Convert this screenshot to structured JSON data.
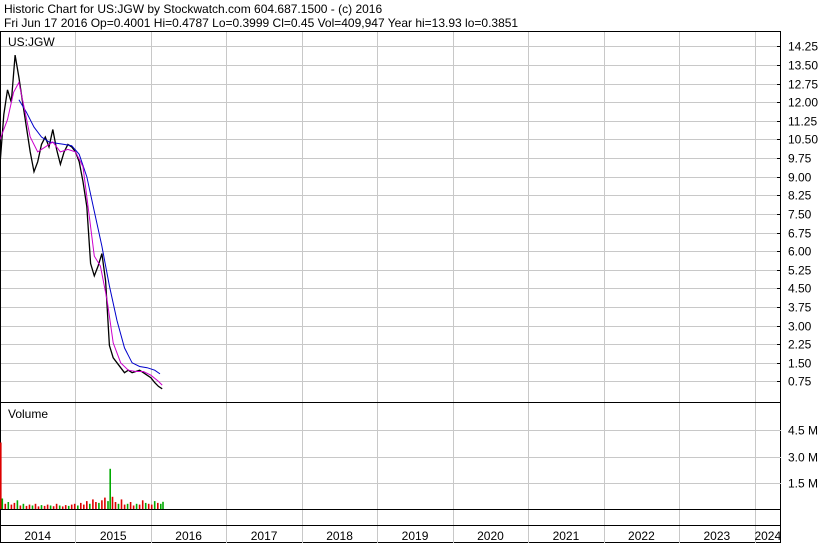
{
  "header": {
    "title": "Historic Chart for US:JGW by Stockwatch.com 604.687.1500 - (c) 2016",
    "quote": "Fri Jun 17 2016   Op=0.4001   Hi=0.4787   Lo=0.3999   Cl=0.45   Vol=409,947   Year hi=13.93   lo=0.3851"
  },
  "chart_data": {
    "type": "line",
    "symbol": "US:JGW",
    "price_ylim": [
      0,
      14.75
    ],
    "price_ticks": [
      "14.25",
      "13.50",
      "12.75",
      "12.00",
      "11.25",
      "10.50",
      "9.75",
      "9.00",
      "8.25",
      "7.50",
      "6.75",
      "6.00",
      "5.25",
      "4.50",
      "3.75",
      "3.00",
      "2.25",
      "1.50",
      "0.75"
    ],
    "x_ticks": [
      "2014",
      "2015",
      "2016",
      "2017",
      "2018",
      "2019",
      "2020",
      "2021",
      "2022",
      "2023",
      "2024"
    ],
    "grid": true,
    "colors": {
      "price": "#000000",
      "ma_short": "#cc00cc",
      "ma_long": "#0000cc",
      "vol_up": "#00aa00",
      "vol_down": "#dd0000"
    },
    "price_series": [
      {
        "t": 2014.0,
        "v": 9.5
      },
      {
        "t": 2014.05,
        "v": 11.5
      },
      {
        "t": 2014.1,
        "v": 12.5
      },
      {
        "t": 2014.15,
        "v": 12.0
      },
      {
        "t": 2014.2,
        "v": 13.9
      },
      {
        "t": 2014.25,
        "v": 13.0
      },
      {
        "t": 2014.3,
        "v": 12.0
      },
      {
        "t": 2014.35,
        "v": 11.0
      },
      {
        "t": 2014.4,
        "v": 10.0
      },
      {
        "t": 2014.45,
        "v": 9.2
      },
      {
        "t": 2014.5,
        "v": 9.6
      },
      {
        "t": 2014.55,
        "v": 10.3
      },
      {
        "t": 2014.6,
        "v": 10.6
      },
      {
        "t": 2014.65,
        "v": 10.2
      },
      {
        "t": 2014.7,
        "v": 10.9
      },
      {
        "t": 2014.75,
        "v": 10.1
      },
      {
        "t": 2014.8,
        "v": 9.5
      },
      {
        "t": 2014.85,
        "v": 10.0
      },
      {
        "t": 2014.9,
        "v": 10.3
      },
      {
        "t": 2014.95,
        "v": 10.2
      },
      {
        "t": 2015.0,
        "v": 10.0
      },
      {
        "t": 2015.05,
        "v": 9.6
      },
      {
        "t": 2015.1,
        "v": 8.8
      },
      {
        "t": 2015.15,
        "v": 7.8
      },
      {
        "t": 2015.2,
        "v": 5.5
      },
      {
        "t": 2015.25,
        "v": 5.0
      },
      {
        "t": 2015.3,
        "v": 5.4
      },
      {
        "t": 2015.35,
        "v": 5.9
      },
      {
        "t": 2015.4,
        "v": 4.8
      },
      {
        "t": 2015.45,
        "v": 2.2
      },
      {
        "t": 2015.5,
        "v": 1.7
      },
      {
        "t": 2015.55,
        "v": 1.5
      },
      {
        "t": 2015.6,
        "v": 1.3
      },
      {
        "t": 2015.65,
        "v": 1.1
      },
      {
        "t": 2015.7,
        "v": 1.2
      },
      {
        "t": 2015.75,
        "v": 1.1
      },
      {
        "t": 2015.8,
        "v": 1.15
      },
      {
        "t": 2015.85,
        "v": 1.2
      },
      {
        "t": 2015.9,
        "v": 1.1
      },
      {
        "t": 2015.95,
        "v": 1.0
      },
      {
        "t": 2016.0,
        "v": 0.9
      },
      {
        "t": 2016.05,
        "v": 0.7
      },
      {
        "t": 2016.1,
        "v": 0.55
      },
      {
        "t": 2016.15,
        "v": 0.45
      }
    ],
    "ma_short": [
      {
        "t": 2014.0,
        "v": 10.5
      },
      {
        "t": 2014.1,
        "v": 11.3
      },
      {
        "t": 2014.18,
        "v": 12.4
      },
      {
        "t": 2014.25,
        "v": 12.8
      },
      {
        "t": 2014.32,
        "v": 11.8
      },
      {
        "t": 2014.4,
        "v": 10.6
      },
      {
        "t": 2014.5,
        "v": 10.0
      },
      {
        "t": 2014.6,
        "v": 10.2
      },
      {
        "t": 2014.7,
        "v": 10.4
      },
      {
        "t": 2014.8,
        "v": 10.0
      },
      {
        "t": 2014.9,
        "v": 10.1
      },
      {
        "t": 2015.0,
        "v": 10.0
      },
      {
        "t": 2015.1,
        "v": 9.4
      },
      {
        "t": 2015.18,
        "v": 7.5
      },
      {
        "t": 2015.25,
        "v": 5.8
      },
      {
        "t": 2015.33,
        "v": 5.4
      },
      {
        "t": 2015.42,
        "v": 4.0
      },
      {
        "t": 2015.5,
        "v": 2.3
      },
      {
        "t": 2015.6,
        "v": 1.5
      },
      {
        "t": 2015.7,
        "v": 1.2
      },
      {
        "t": 2015.8,
        "v": 1.15
      },
      {
        "t": 2015.9,
        "v": 1.15
      },
      {
        "t": 2016.0,
        "v": 1.0
      },
      {
        "t": 2016.1,
        "v": 0.75
      },
      {
        "t": 2016.15,
        "v": 0.6
      }
    ],
    "ma_long": [
      {
        "t": 2014.25,
        "v": 12.1
      },
      {
        "t": 2014.35,
        "v": 11.6
      },
      {
        "t": 2014.45,
        "v": 11.0
      },
      {
        "t": 2014.55,
        "v": 10.6
      },
      {
        "t": 2014.65,
        "v": 10.4
      },
      {
        "t": 2014.75,
        "v": 10.35
      },
      {
        "t": 2014.85,
        "v": 10.3
      },
      {
        "t": 2014.95,
        "v": 10.25
      },
      {
        "t": 2015.05,
        "v": 9.9
      },
      {
        "t": 2015.15,
        "v": 9.0
      },
      {
        "t": 2015.25,
        "v": 7.6
      },
      {
        "t": 2015.35,
        "v": 6.2
      },
      {
        "t": 2015.45,
        "v": 4.6
      },
      {
        "t": 2015.55,
        "v": 3.2
      },
      {
        "t": 2015.65,
        "v": 2.1
      },
      {
        "t": 2015.75,
        "v": 1.5
      },
      {
        "t": 2015.85,
        "v": 1.35
      },
      {
        "t": 2015.95,
        "v": 1.3
      },
      {
        "t": 2016.05,
        "v": 1.2
      },
      {
        "t": 2016.12,
        "v": 1.05
      }
    ],
    "volume": {
      "label": "Volume",
      "ylim": [
        0,
        6000000
      ],
      "ticks": [
        "4.5 M",
        "3.0 M",
        "1.5 M"
      ],
      "bars": [
        {
          "t": 2014.0,
          "v": 3800000,
          "up": false
        },
        {
          "t": 2014.02,
          "v": 600000,
          "up": true
        },
        {
          "t": 2014.06,
          "v": 300000,
          "up": false
        },
        {
          "t": 2014.1,
          "v": 400000,
          "up": true
        },
        {
          "t": 2014.14,
          "v": 250000,
          "up": false
        },
        {
          "t": 2014.18,
          "v": 350000,
          "up": false
        },
        {
          "t": 2014.22,
          "v": 500000,
          "up": true
        },
        {
          "t": 2014.26,
          "v": 200000,
          "up": false
        },
        {
          "t": 2014.3,
          "v": 300000,
          "up": true
        },
        {
          "t": 2014.34,
          "v": 180000,
          "up": false
        },
        {
          "t": 2014.38,
          "v": 250000,
          "up": false
        },
        {
          "t": 2014.42,
          "v": 200000,
          "up": true
        },
        {
          "t": 2014.46,
          "v": 300000,
          "up": false
        },
        {
          "t": 2014.5,
          "v": 150000,
          "up": false
        },
        {
          "t": 2014.54,
          "v": 220000,
          "up": true
        },
        {
          "t": 2014.58,
          "v": 180000,
          "up": false
        },
        {
          "t": 2014.62,
          "v": 250000,
          "up": false
        },
        {
          "t": 2014.66,
          "v": 200000,
          "up": true
        },
        {
          "t": 2014.7,
          "v": 160000,
          "up": false
        },
        {
          "t": 2014.74,
          "v": 300000,
          "up": false
        },
        {
          "t": 2014.78,
          "v": 200000,
          "up": true
        },
        {
          "t": 2014.82,
          "v": 150000,
          "up": false
        },
        {
          "t": 2014.86,
          "v": 220000,
          "up": false
        },
        {
          "t": 2014.9,
          "v": 180000,
          "up": true
        },
        {
          "t": 2014.94,
          "v": 250000,
          "up": false
        },
        {
          "t": 2014.98,
          "v": 300000,
          "up": false
        },
        {
          "t": 2015.02,
          "v": 200000,
          "up": true
        },
        {
          "t": 2015.06,
          "v": 350000,
          "up": false
        },
        {
          "t": 2015.1,
          "v": 250000,
          "up": false
        },
        {
          "t": 2015.14,
          "v": 450000,
          "up": false
        },
        {
          "t": 2015.18,
          "v": 300000,
          "up": true
        },
        {
          "t": 2015.22,
          "v": 550000,
          "up": false
        },
        {
          "t": 2015.26,
          "v": 400000,
          "up": false
        },
        {
          "t": 2015.3,
          "v": 350000,
          "up": true
        },
        {
          "t": 2015.34,
          "v": 500000,
          "up": false
        },
        {
          "t": 2015.38,
          "v": 650000,
          "up": false
        },
        {
          "t": 2015.42,
          "v": 450000,
          "up": true
        },
        {
          "t": 2015.45,
          "v": 2300000,
          "up": true
        },
        {
          "t": 2015.48,
          "v": 700000,
          "up": false
        },
        {
          "t": 2015.52,
          "v": 400000,
          "up": false
        },
        {
          "t": 2015.56,
          "v": 300000,
          "up": true
        },
        {
          "t": 2015.6,
          "v": 550000,
          "up": false
        },
        {
          "t": 2015.64,
          "v": 250000,
          "up": false
        },
        {
          "t": 2015.68,
          "v": 300000,
          "up": true
        },
        {
          "t": 2015.72,
          "v": 400000,
          "up": false
        },
        {
          "t": 2015.76,
          "v": 200000,
          "up": false
        },
        {
          "t": 2015.8,
          "v": 300000,
          "up": true
        },
        {
          "t": 2015.84,
          "v": 250000,
          "up": false
        },
        {
          "t": 2015.88,
          "v": 500000,
          "up": false
        },
        {
          "t": 2015.92,
          "v": 350000,
          "up": true
        },
        {
          "t": 2015.96,
          "v": 300000,
          "up": false
        },
        {
          "t": 2016.0,
          "v": 250000,
          "up": false
        },
        {
          "t": 2016.04,
          "v": 450000,
          "up": true
        },
        {
          "t": 2016.08,
          "v": 350000,
          "up": false
        },
        {
          "t": 2016.12,
          "v": 300000,
          "up": true
        },
        {
          "t": 2016.15,
          "v": 409947,
          "up": true
        }
      ]
    }
  }
}
